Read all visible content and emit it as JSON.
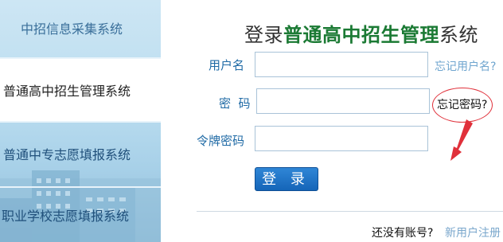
{
  "sidebar": {
    "items": [
      {
        "label": "中招信息采集系统"
      },
      {
        "label": "普通高中招生管理系统"
      },
      {
        "label": "普通中专志愿填报系统"
      },
      {
        "label": "职业学校志愿填报系统"
      }
    ],
    "active_index": 1
  },
  "header": {
    "title_prefix": "登录",
    "title_highlight": "普通高中招生管理",
    "title_suffix": "系统"
  },
  "form": {
    "username_label": "用户名",
    "username_value": "",
    "password_label": "密  码",
    "password_value": "",
    "token_label": "令牌密码",
    "token_value": "",
    "forgot_username": "忘记用户名?",
    "forgot_password": "忘记密码?",
    "login_button": "登 录"
  },
  "footer": {
    "no_account": "还没有账号?",
    "register": "新用户注册"
  },
  "colors": {
    "title_highlight": "#1b7a34",
    "button": "#1b6fc4",
    "annotation": "#e0303a",
    "label": "#1f6aa5"
  }
}
